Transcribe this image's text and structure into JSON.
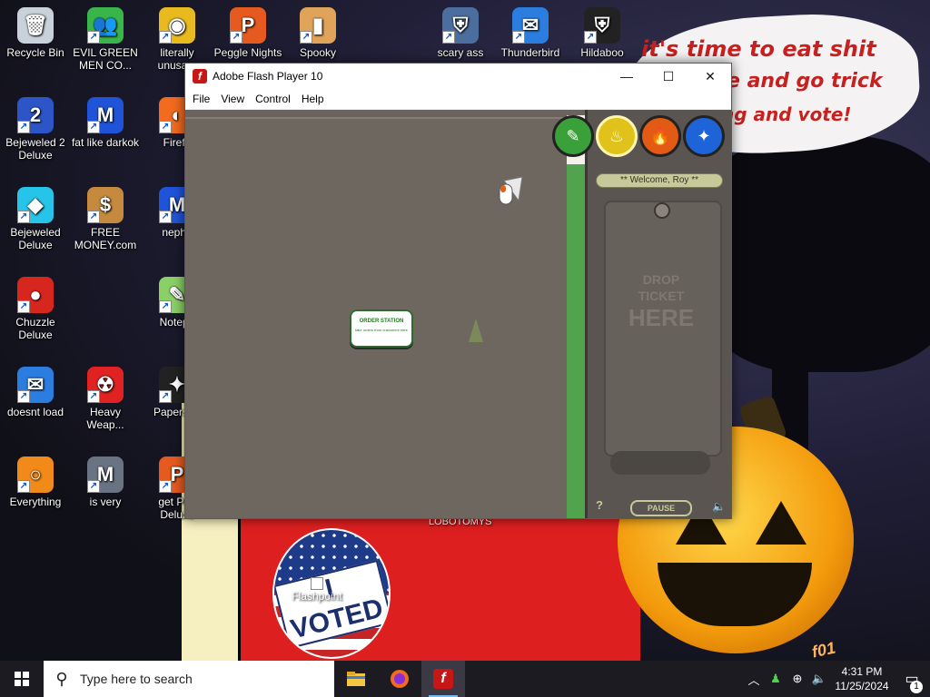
{
  "desktop": {
    "icons": [
      {
        "label": "Recycle Bin",
        "icon": "recycle-bin-icon",
        "color": "#c9d2da",
        "shortcut": false
      },
      {
        "label": "EVIL GREEN MEN CO...",
        "icon": "green-men-icon",
        "color": "#39b54a",
        "shortcut": true
      },
      {
        "label": "literally unusa...",
        "icon": "chrome-icon",
        "color": "#e8ba1f",
        "shortcut": true
      },
      {
        "label": "Peggle Nights",
        "icon": "peggle-icon",
        "color": "#e65a1f",
        "shortcut": true
      },
      {
        "label": "Spooky",
        "icon": "spooky-icon",
        "color": "#e0a35a",
        "shortcut": true
      },
      {
        "label": "scary ass",
        "icon": "scary-shield-icon",
        "color": "#4b6e9e",
        "shortcut": true
      },
      {
        "label": "Thunderbird",
        "icon": "thunderbird-icon",
        "color": "#2b7de0",
        "shortcut": true
      },
      {
        "label": "Hildaboo",
        "icon": "yashma-shield-icon",
        "color": "#222222",
        "shortcut": true
      },
      {
        "label": "Bejeweled 2 Deluxe",
        "icon": "bejeweled-2-icon",
        "color": "#2c55c8",
        "shortcut": true
      },
      {
        "label": "fat like darkok",
        "icon": "mpl-icon",
        "color": "#2054d8",
        "shortcut": true
      },
      {
        "label": "Firefo",
        "icon": "firefox-icon",
        "color": "#f26b1f",
        "shortcut": true
      },
      {
        "label": "Bejeweled Deluxe",
        "icon": "diamond-icon",
        "color": "#27c4ea",
        "shortcut": true
      },
      {
        "label": "FREE MONEY.com",
        "icon": "money-bag-icon",
        "color": "#c58a3d",
        "shortcut": true
      },
      {
        "label": "nepha",
        "icon": "mpl-icon",
        "color": "#2054d8",
        "shortcut": true
      },
      {
        "label": "Chuzzle Deluxe",
        "icon": "chuzzle-icon",
        "color": "#d7261e",
        "shortcut": true
      },
      {
        "label": "Notepa",
        "icon": "notepad-icon",
        "color": "#8bd067",
        "shortcut": true
      },
      {
        "label": "doesnt load",
        "icon": "thunderbird-icon",
        "color": "#2b7de0",
        "shortcut": true
      },
      {
        "label": "Heavy Weap...",
        "icon": "radiation-icon",
        "color": "#e02222",
        "shortcut": true
      },
      {
        "label": "Papers, F",
        "icon": "papers-icon",
        "color": "#222222",
        "shortcut": true
      },
      {
        "label": "Everything",
        "icon": "magnifier-icon",
        "color": "#f28a1a",
        "shortcut": true
      },
      {
        "label": "is very",
        "icon": "mpl-shield-icon",
        "color": "#6a7384",
        "shortcut": true
      },
      {
        "label": "get Peg Deluxe",
        "icon": "peggle-icon",
        "color": "#e65a1f",
        "shortcut": true
      }
    ],
    "speech_bubble": [
      "it's time to eat shit",
      "e and go trick",
      "ng and vote!"
    ],
    "lobotomys": "LOBOTOMYS",
    "flashpoint": "Flashpoint",
    "voted_badge": "I VOTED",
    "pumpkin_scribble": "f01"
  },
  "window": {
    "title": "Adobe Flash Player 10",
    "menu": [
      "File",
      "View",
      "Control",
      "Help"
    ],
    "controls": {
      "minimize": "—",
      "maximize": "☐",
      "close": "✕"
    },
    "game": {
      "welcome": "** Welcome, Roy **",
      "ticket_lines": [
        "DROP",
        "TICKET",
        "HERE"
      ],
      "order_station_title": "ORDER STATION",
      "order_station_sub": "take orders from customers here",
      "pause": "PAUSE",
      "help": "?",
      "buttons": [
        {
          "name": "order-station-nav",
          "color": "#3aa13a",
          "glyph": "✎"
        },
        {
          "name": "grill-station-nav",
          "color": "#e0c21a",
          "glyph": "♨"
        },
        {
          "name": "fire-station-nav",
          "color": "#e25a14",
          "glyph": "🔥"
        },
        {
          "name": "build-station-nav",
          "color": "#1e64d8",
          "glyph": "✦"
        }
      ]
    }
  },
  "taskbar": {
    "search_placeholder": "Type here to search",
    "time": "4:31 PM",
    "date": "11/25/2024",
    "notification_count": "1",
    "apps": [
      {
        "name": "file-explorer",
        "icon": "folder-icon",
        "active": false
      },
      {
        "name": "firefox",
        "icon": "firefox-icon",
        "active": false
      },
      {
        "name": "flash-player",
        "icon": "flash-icon",
        "active": true
      }
    ]
  }
}
